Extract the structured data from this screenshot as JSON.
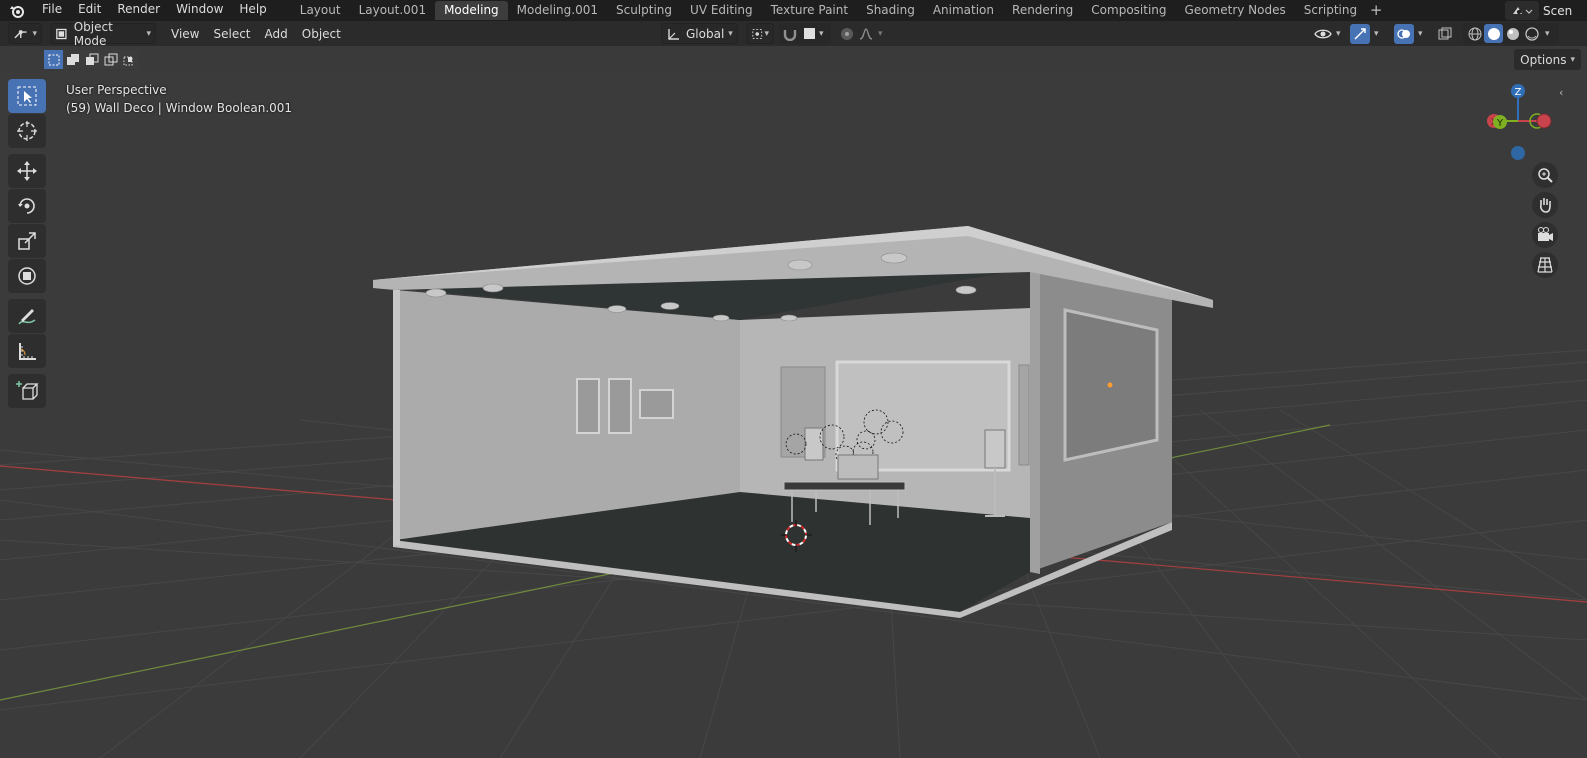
{
  "topbar": {
    "menus": [
      "File",
      "Edit",
      "Render",
      "Window",
      "Help"
    ],
    "workspaces": [
      "Layout",
      "Layout.001",
      "Modeling",
      "Modeling.001",
      "Sculpting",
      "UV Editing",
      "Texture Paint",
      "Shading",
      "Animation",
      "Rendering",
      "Compositing",
      "Geometry Nodes",
      "Scripting"
    ],
    "active_workspace": "Modeling",
    "add_tab": "+",
    "scene_label": "Scen"
  },
  "header": {
    "mode": "Object Mode",
    "menus": [
      "View",
      "Select",
      "Add",
      "Object"
    ],
    "transform_orientation": "Global"
  },
  "toolsettings": {
    "options_label": "Options"
  },
  "viewport": {
    "perspective": "User Perspective",
    "active_object": "(59) Wall Deco | Window Boolean.001"
  },
  "gizmo": {
    "z_label": "Z",
    "y_label": "Y",
    "x_label": "X"
  },
  "colors": {
    "accent": "#4772b3",
    "x_axis": "#c8434b",
    "y_axis": "#7fb021",
    "z_axis": "#2e6fb7"
  }
}
